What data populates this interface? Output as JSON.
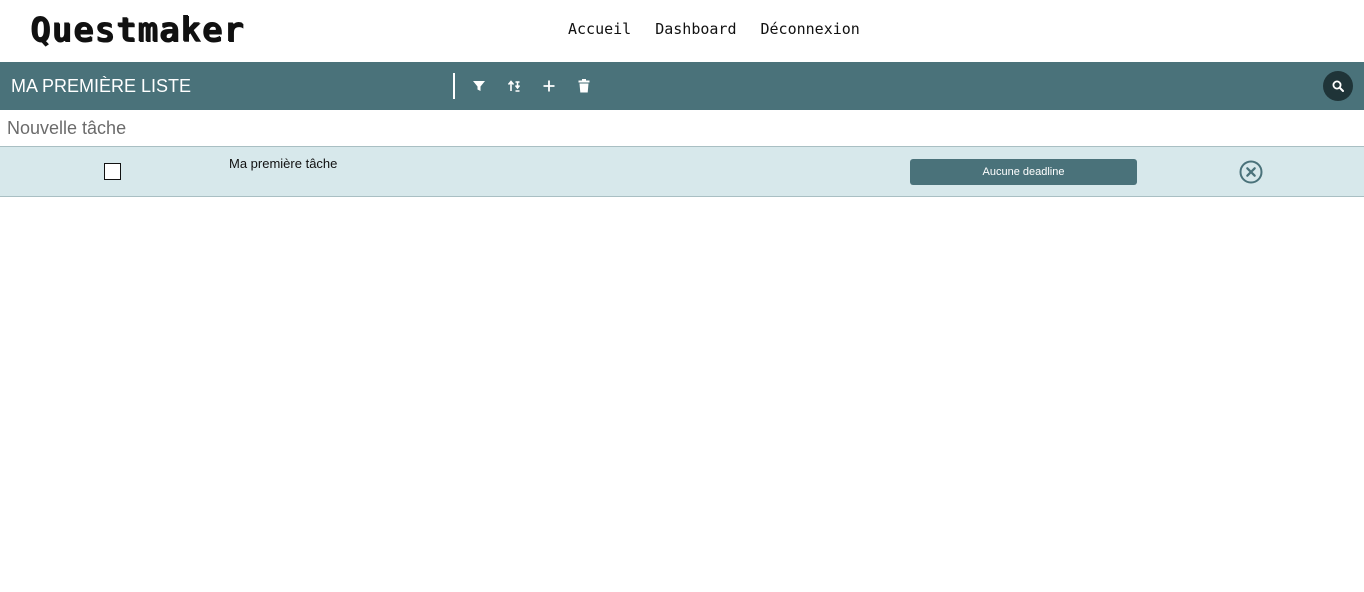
{
  "app": {
    "logo": "Questmaker"
  },
  "nav": {
    "items": [
      {
        "label": "Accueil"
      },
      {
        "label": "Dashboard"
      },
      {
        "label": "Déconnexion"
      }
    ]
  },
  "list": {
    "title": "MA PREMIÈRE LISTE",
    "toolbar_icons": [
      "filter-icon",
      "sort-icon",
      "plus-icon",
      "trash-icon"
    ],
    "search_icon": "search-icon"
  },
  "new_task": {
    "placeholder": "Nouvelle tâche",
    "value": ""
  },
  "tasks": [
    {
      "label": "Ma première tâche",
      "checked": false,
      "deadline_label": "Aucune deadline"
    }
  ],
  "colors": {
    "accent": "#4a727a",
    "row_background": "#d7e8eb",
    "search_button": "#1f3438"
  }
}
